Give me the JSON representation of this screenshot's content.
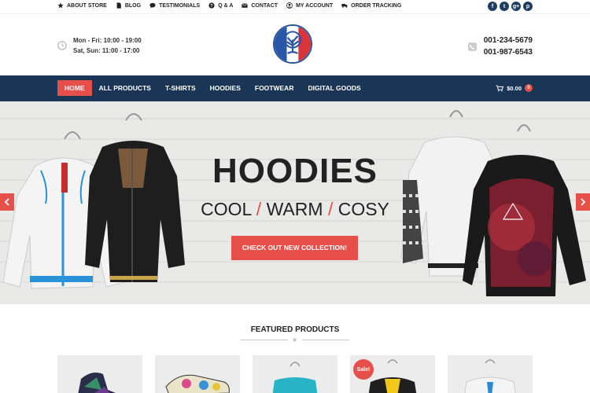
{
  "topbar": {
    "links": [
      {
        "label": "ABOUT STORE",
        "icon": "star-icon"
      },
      {
        "label": "BLOG",
        "icon": "document-icon"
      },
      {
        "label": "TESTIMONIALS",
        "icon": "chat-icon"
      },
      {
        "label": "Q & A",
        "icon": "question-icon"
      },
      {
        "label": "CONTACT",
        "icon": "envelope-icon"
      },
      {
        "label": "MY ACCOUNT",
        "icon": "user-icon"
      },
      {
        "label": "ORDER TRACKING",
        "icon": "truck-icon"
      }
    ],
    "social": [
      "f",
      "t",
      "g+",
      "p"
    ]
  },
  "header": {
    "hours_weekday": "Mon - Fri: 10:00 - 19:00",
    "hours_weekend": "Sat, Sun: 11:00 - 17:00",
    "phone_1": "001-234-5679",
    "phone_2": "001-987-6543"
  },
  "nav": {
    "items": [
      "HOME",
      "ALL PRODUCTS",
      "T-SHIRTS",
      "HOODIES",
      "FOOTWEAR",
      "DIGITAL GOODS"
    ],
    "active_index": 0,
    "cart_total": "$0.00",
    "cart_count": "0"
  },
  "hero": {
    "title": "HOODIES",
    "sub_1": "COOL",
    "sub_2": "WARM",
    "sub_3": "COSY",
    "separator": "/",
    "button": "CHECK OUT NEW COLLECTION!"
  },
  "featured": {
    "title": "FEATURED PRODUCTS",
    "sale_label": "Sale!"
  },
  "colors": {
    "accent": "#e7504a",
    "nav": "#1b3556"
  }
}
